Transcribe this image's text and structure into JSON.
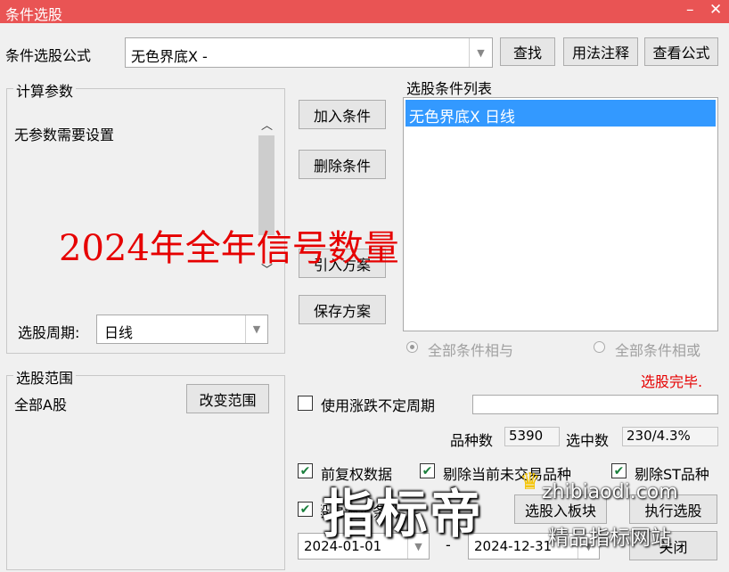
{
  "window": {
    "title": "条件选股",
    "min_icon": "minimize-icon",
    "close_icon": "close-icon"
  },
  "formula": {
    "label": "条件选股公式",
    "value": "无色界底X  -",
    "find": "查找",
    "usage": "用法注释",
    "view": "查看公式"
  },
  "params": {
    "legend": "计算参数",
    "text": "无参数需要设置",
    "period_label": "选股周期:",
    "period_value": "日线"
  },
  "actions": {
    "add": "加入条件",
    "delete": "删除条件",
    "import": "引入方案",
    "save": "保存方案"
  },
  "condition_list": {
    "label": "选股条件列表",
    "items": [
      "无色界底X  日线"
    ]
  },
  "logic": {
    "and_label": "全部条件相与",
    "or_label": "全部条件相或",
    "status": "选股完毕."
  },
  "range": {
    "legend": "选股范围",
    "value": "全部A股",
    "change": "改变范围"
  },
  "options": {
    "variable_period": "使用涨跌不定周期",
    "variety_label": "品种数",
    "variety_value": "5390",
    "selected_label": "选中数",
    "selected_value": "230/4.3%",
    "fq": "前复权数据",
    "exclude_untraded": "剔除当前未交易品种",
    "exclude_st": "剔除ST品种",
    "period_range_partial": "时间段内满足条件",
    "to_block": "选股入板块",
    "run": "执行选股",
    "date_from": "2024-01-01",
    "date_sep": "-",
    "date_to": "2024-12-31",
    "close": "关闭"
  },
  "overlay": {
    "annotation": "2024年全年信号数量",
    "watermark": "指标帝",
    "watermark_url": "zhibiaodi.com",
    "watermark_sub": "精品指标网站"
  },
  "colors": {
    "titlebar": "#e95454",
    "selection": "#3399ff",
    "status_red": "#e60000",
    "check_green": "#1a7f3c"
  }
}
